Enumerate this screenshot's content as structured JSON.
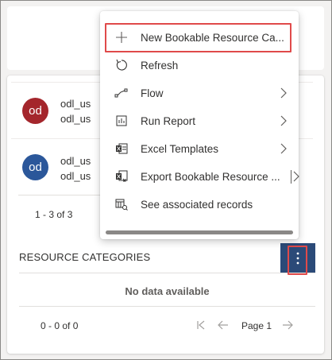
{
  "records": [
    {
      "initials": "od",
      "avatar_color": "#a4262c",
      "line1": "odl_us",
      "line2": "odl_us"
    },
    {
      "initials": "od",
      "avatar_color": "#2b579a",
      "line1": "odl_us",
      "line2": "odl_us"
    }
  ],
  "records_count": "1 - 3 of 3",
  "section": {
    "title": "RESOURCE CATEGORIES",
    "empty_text": "No data available",
    "pager_count": "0 - 0 of 0",
    "page_label": "Page 1"
  },
  "menu": {
    "items": [
      {
        "label": "New Bookable Resource Ca...",
        "icon": "plus-icon"
      },
      {
        "label": "Refresh",
        "icon": "refresh-icon"
      },
      {
        "label": "Flow",
        "icon": "flow-icon",
        "submenu": true
      },
      {
        "label": "Run Report",
        "icon": "report-icon",
        "submenu": true
      },
      {
        "label": "Excel Templates",
        "icon": "excel-icon",
        "submenu": true
      },
      {
        "label": "Export Bookable Resource ...",
        "icon": "export-excel-icon",
        "submenu": true
      },
      {
        "label": "See associated records",
        "icon": "associated-records-icon"
      }
    ]
  },
  "colors": {
    "highlight": "#e04a4a",
    "more_button": "#2b4a78"
  }
}
